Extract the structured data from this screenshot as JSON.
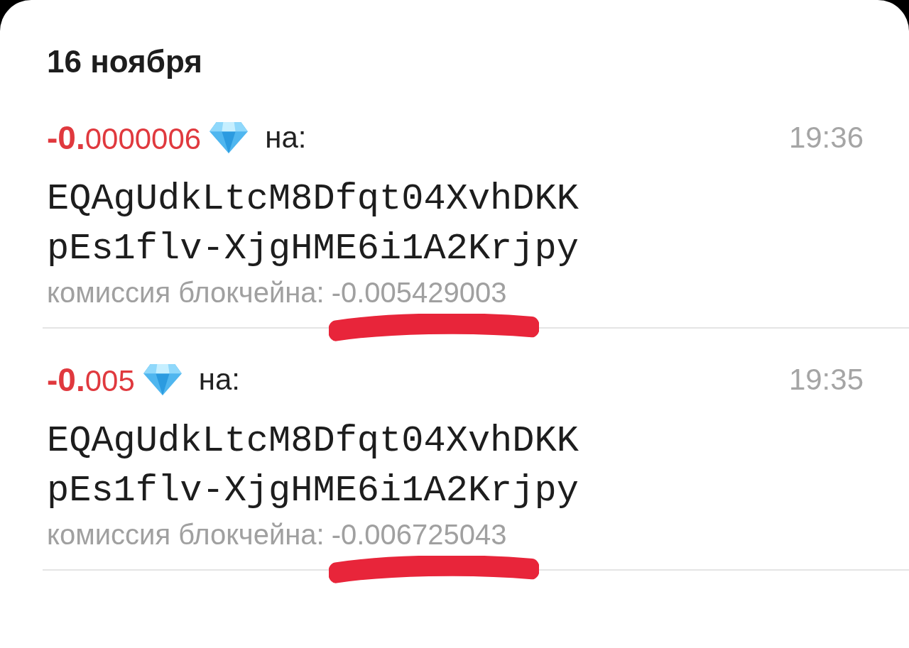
{
  "date": "16 ноября",
  "transactions": [
    {
      "amount": "**-0.**0000006",
      "to_label": "на:",
      "time": "19:36",
      "address_lines": [
        "EQAgUdkLtcM8Dfqt04XvhDKK",
        "pEs1flv-XjgHME6i1A2Krjpy"
      ],
      "fee_label": "комиссия блокчейна:",
      "fee_value": "-0.005429003",
      "underlined": true
    },
    {
      "amount": "**-0.**005",
      "to_label": "на:",
      "time": "19:35",
      "address_lines": [
        "EQAgUdkLtcM8Dfqt04XvhDKK",
        "pEs1flv-XjgHME6i1A2Krjpy"
      ],
      "fee_label": "комиссия блокчейна:",
      "fee_value": "-0.006725043",
      "underlined": true
    }
  ]
}
